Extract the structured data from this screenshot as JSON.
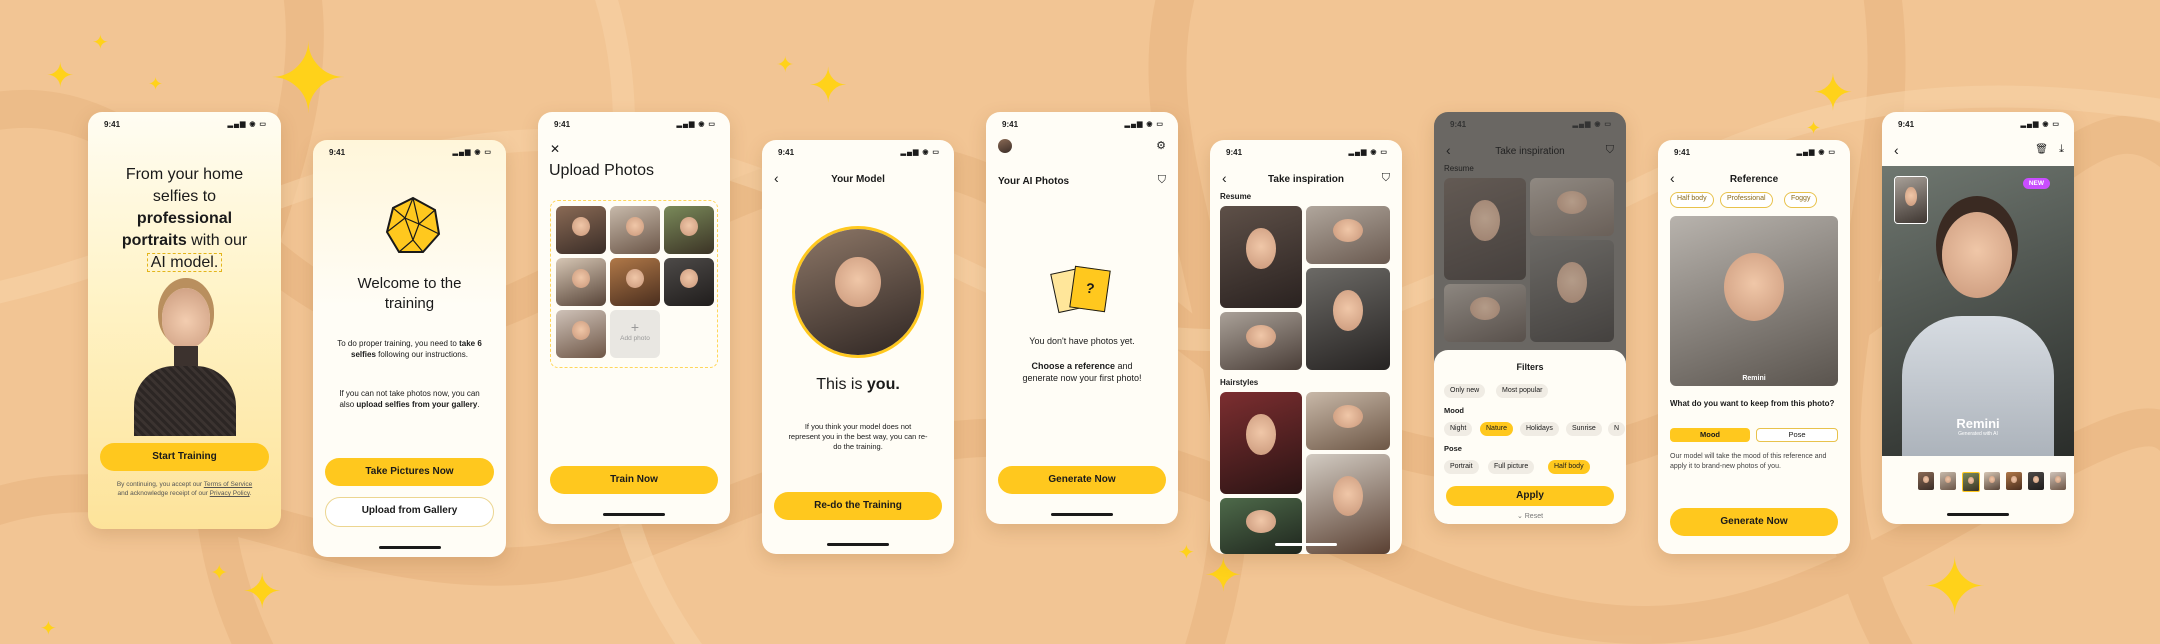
{
  "status": {
    "time": "9:41",
    "sys": "▂▄▆ ◉ ▭"
  },
  "s1": {
    "h_a": "From your home",
    "h_b": "selfies to",
    "h_c": "professional",
    "h_d": "portraits",
    "h_e": " with our",
    "h_f": "AI model.",
    "cta": "Start Training",
    "legal_a": "By continuing, you accept our ",
    "legal_terms": "Terms of Service",
    "legal_b": " and acknowledge receipt of our ",
    "legal_privacy": "Privacy Policy",
    "legal_end": "."
  },
  "s2": {
    "title": "Welcome to the training",
    "p1_a": "To do proper training, you need to ",
    "p1_b": "take 6 selfies",
    "p1_c": " following our instructions.",
    "p2_a": "If you can not take photos now, you can also ",
    "p2_b": "upload selfies from your gallery",
    "p2_c": ".",
    "btn1": "Take Pictures Now",
    "btn2": "Upload from Gallery"
  },
  "s3": {
    "close": "✕",
    "title": "Upload Photos",
    "add": "Add photo",
    "plus": "+",
    "cta": "Train Now"
  },
  "s4": {
    "title": "Your Model",
    "big_a": "This is ",
    "big_b": "you.",
    "body": "If you think your model does not represent you in the best way, you can re-do the training.",
    "cta": "Re-do the Training"
  },
  "s5": {
    "title": "Your AI Photos",
    "empty": "You don't have photos yet.",
    "cta_a": "Choose a reference",
    "cta_b": " and generate now your first photo!",
    "q": "?",
    "cta": "Generate Now"
  },
  "s6": {
    "title": "Take inspiration",
    "sec1": "Resume",
    "sec2": "Hairstyles"
  },
  "s7": {
    "title": "Take inspiration",
    "sec1": "Resume",
    "sheet_title": "Filters",
    "top": [
      "Only new",
      "Most popular"
    ],
    "mood_label": "Mood",
    "mood": [
      "Night",
      "Nature",
      "Holidays",
      "Sunrise",
      "N"
    ],
    "pose_label": "Pose",
    "pose": [
      "Portrait",
      "Full picture",
      "Half body"
    ],
    "apply": "Apply",
    "reset": "Reset"
  },
  "s8": {
    "title": "Reference",
    "tags": [
      "Half body",
      "Professional",
      "Foggy"
    ],
    "img_label": "Remini",
    "q": "What do you want to keep from this photo?",
    "opt1": "Mood",
    "opt2": "Pose",
    "desc": "Our model will take the mood of this reference and apply it to brand-new photos of you.",
    "cta": "Generate Now"
  },
  "s9": {
    "badge": "NEW",
    "brand": "Remini",
    "brand_sub": "Generated with AI"
  },
  "colors": {
    "accent": "#ffc81e",
    "bg": "#f2c594",
    "badge": "#c94dff"
  }
}
